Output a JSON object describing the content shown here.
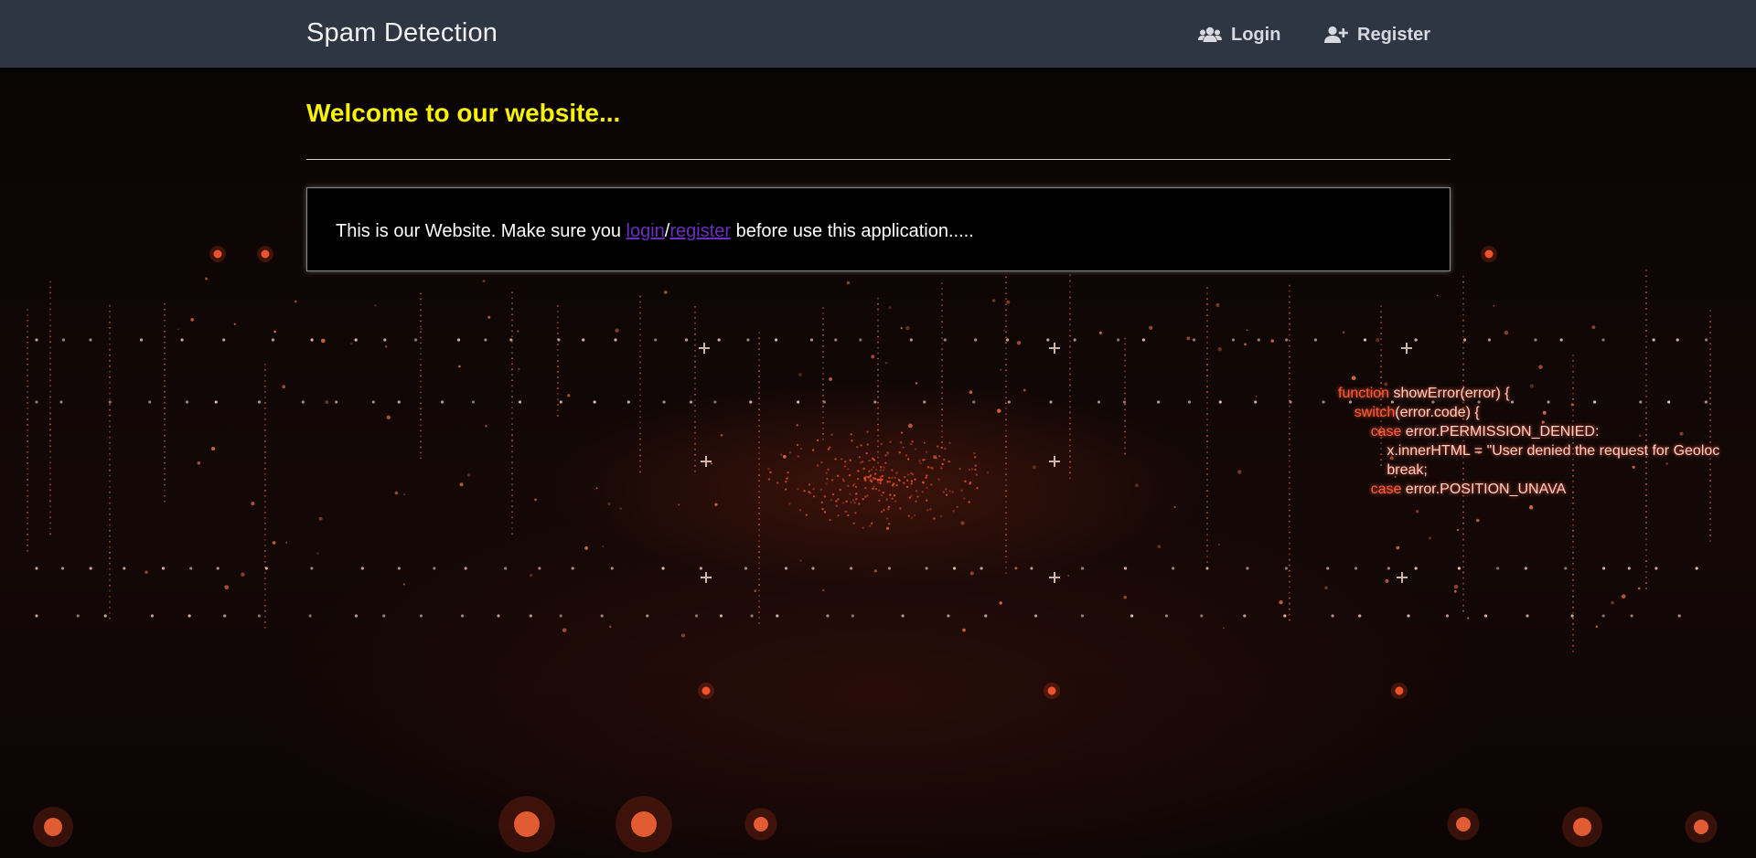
{
  "app": {
    "brand": "Spam Detection"
  },
  "nav": {
    "login_label": "Login",
    "register_label": "Register",
    "login_icon": "users-icon",
    "register_icon": "user-plus-icon"
  },
  "main": {
    "welcome_heading": "Welcome to our website...",
    "message_prefix": "This is our Website. Make sure you ",
    "login_link": "login",
    "separator": "/",
    "register_link": "register",
    "message_suffix": " before use this application....."
  },
  "background_code": {
    "lines": [
      {
        "kw": "function",
        "rest": " showError(error) {"
      },
      {
        "kw": "    switch",
        "rest": "(error.code) {"
      },
      {
        "kw": "        case",
        "rest": " error.PERMISSION_DENIED:"
      },
      {
        "kw": "",
        "rest": "            x.innerHTML = \"User denied the request for Geoloc"
      },
      {
        "kw": "",
        "rest": "            break;"
      },
      {
        "kw": "        case",
        "rest": " error.POSITION_UNAVA"
      }
    ]
  },
  "colors": {
    "navbar": "#2e3644",
    "heading": "#f7f300",
    "link": "#6b2fbf",
    "accent_glow": "#ff5a3c"
  }
}
